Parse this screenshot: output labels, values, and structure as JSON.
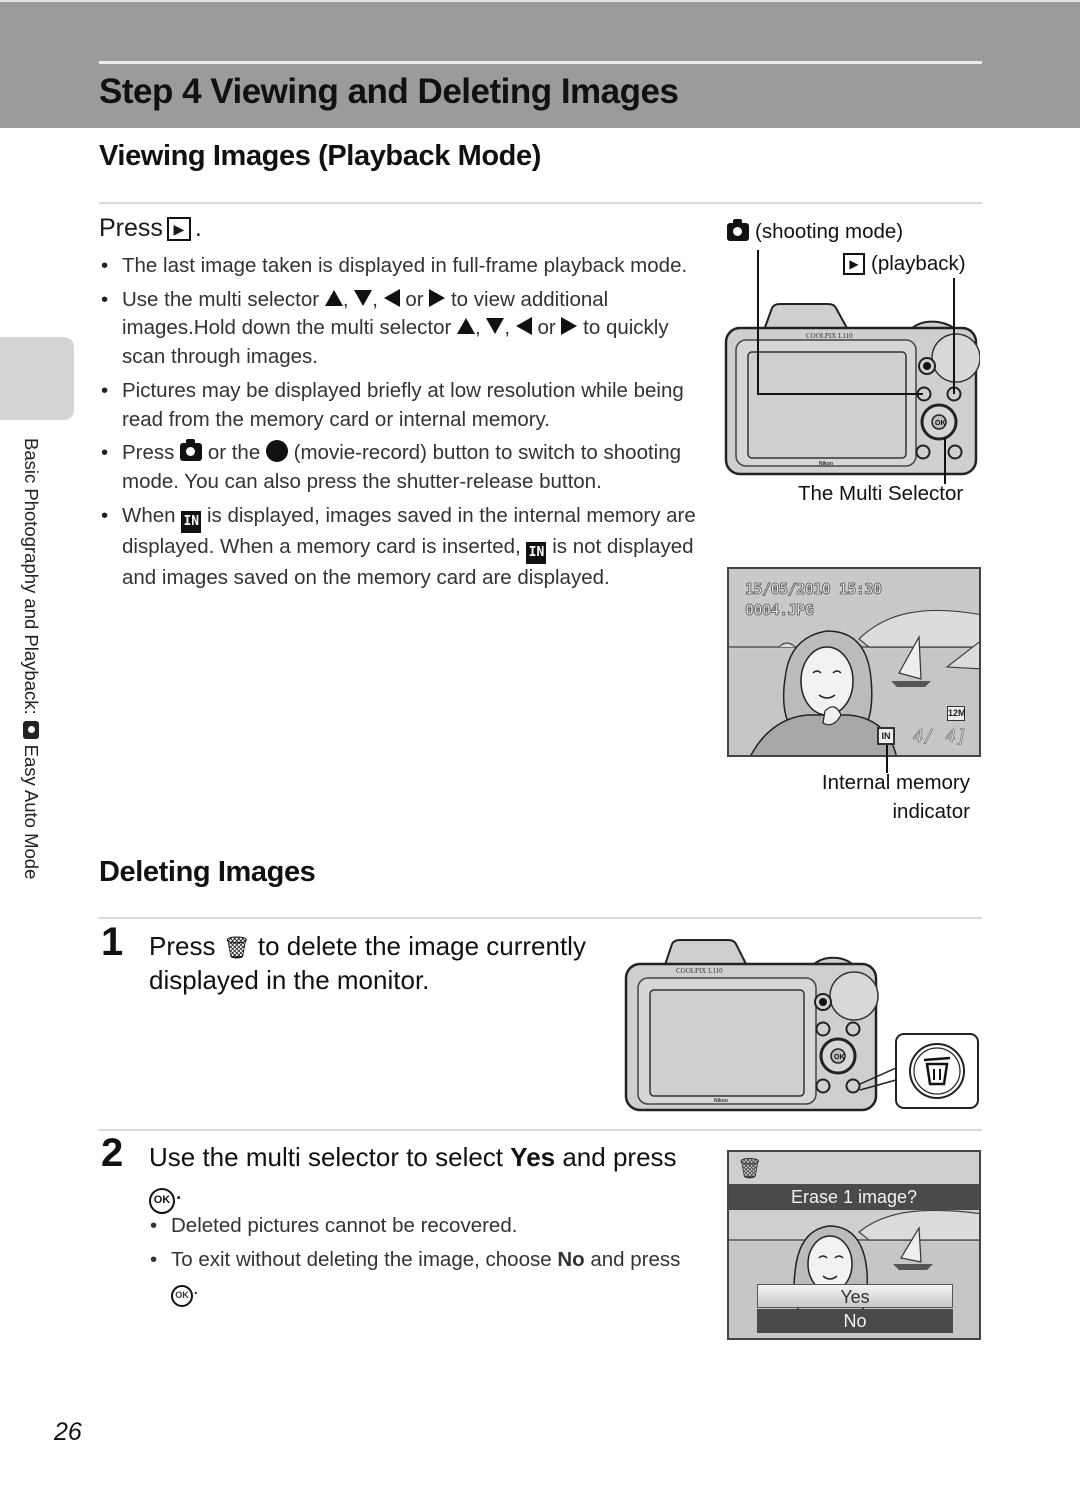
{
  "header": {
    "title": "Step 4 Viewing and Deleting Images"
  },
  "side_tab": {
    "text_before": "Basic Photography and Playback:",
    "icon": "easy-auto-camera-icon",
    "text_after": "Easy Auto Mode"
  },
  "viewing": {
    "title": "Viewing Images (Playback Mode)",
    "press_label": "Press",
    "press_key_icon": "playback-key-icon",
    "press_key_glyph": "▶",
    "press_suffix": ".",
    "bullets": [
      {
        "text": "The last image taken is displayed in full-frame playback mode."
      },
      {
        "part1": "Use the multi selector",
        "part2": "or",
        "part3": "to view additional images.Hold down the multi selector",
        "part4": "or",
        "part5": "to quickly scan through images.",
        "sep": ","
      },
      {
        "text": "Pictures may be displayed briefly at low resolution while being read from the memory card or internal memory."
      },
      {
        "part1": "Press",
        "part2": "or the",
        "part3": "(movie-record) button to switch to shooting mode. You can also press the shutter-release button."
      },
      {
        "part1": "When",
        "part2": "is displayed, images saved in the internal memory are displayed. When a memory card is inserted,",
        "part3": "is not displayed and images saved on the memory card are displayed.",
        "in_glyph": "IN"
      }
    ],
    "figure1": {
      "shooting_label": "(shooting mode)",
      "playback_label": "(playback)",
      "playback_glyph": "▶",
      "multi_selector_label": "The Multi Selector",
      "camera_model": "COOLPIX L110",
      "brand": "Nikon"
    },
    "figure2": {
      "datetime": "15/05/2010 15:30",
      "filename": "0004.JPG",
      "counter": "4/   4]",
      "in_glyph": "IN",
      "size_glyph": "12M",
      "caption_line1": "Internal memory",
      "caption_line2": "indicator"
    }
  },
  "deleting": {
    "title": "Deleting Images",
    "step1": {
      "number": "1",
      "press": "Press",
      "trash_glyph": "🗑",
      "text_after": "to delete the image currently displayed in the monitor."
    },
    "step2": {
      "number": "2",
      "text_before": "Use the multi selector to select",
      "bold_word": "Yes",
      "text_after": "and press",
      "ok_glyph": "OK",
      "suffix": ".",
      "bullets": [
        {
          "text": "Deleted pictures cannot be recovered."
        },
        {
          "part1": "To exit without deleting the image, choose",
          "bold": "No",
          "part2": "and press",
          "suffix": "."
        }
      ]
    },
    "erase_screen": {
      "prompt": "Erase 1 image?",
      "options": [
        "Yes",
        "No"
      ],
      "selected": "Yes",
      "trash_glyph": "🗑"
    }
  },
  "footer": {
    "page_number": "26"
  }
}
